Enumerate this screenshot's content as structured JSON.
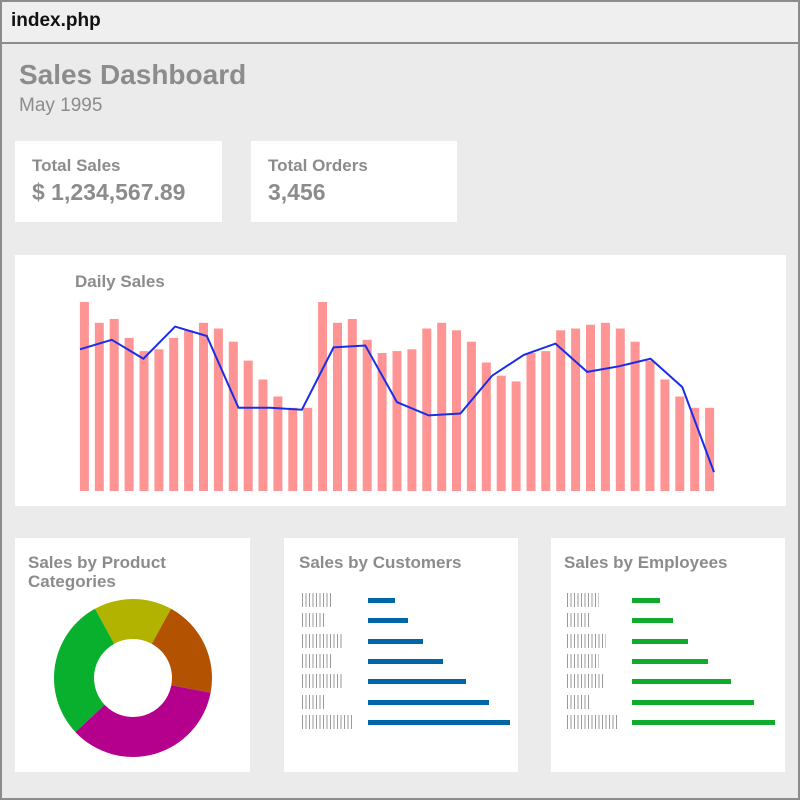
{
  "window": {
    "title": "index.php"
  },
  "header": {
    "title": "Sales Dashboard",
    "subtitle": "May 1995"
  },
  "kpis": {
    "total_sales": {
      "label": "Total Sales",
      "value": "$ 1,234,567.89"
    },
    "total_orders": {
      "label": "Total Orders",
      "value": "3,456"
    }
  },
  "daily_sales": {
    "title": "Daily Sales",
    "chart_data": {
      "type": "bar",
      "bar_color": "#ff9494",
      "line_color": "#1a2ee8",
      "series": [
        {
          "values": [
            100,
            89,
            91,
            81,
            74,
            75,
            81,
            85,
            89,
            86,
            79,
            69,
            59,
            50,
            44,
            44,
            100,
            89,
            91,
            80,
            73,
            74,
            75,
            86,
            89,
            85,
            79,
            68,
            61,
            58,
            73,
            74,
            85,
            86,
            88,
            89,
            86,
            79,
            69,
            59,
            50,
            44,
            44
          ]
        },
        {
          "values": [
            75,
            80,
            70,
            87,
            82,
            44,
            44,
            43,
            76,
            77,
            47,
            40,
            41,
            61,
            72,
            78,
            63,
            66,
            70,
            55,
            10
          ]
        }
      ]
    }
  },
  "categories": {
    "title": "Sales by Product Categories",
    "chart_data": {
      "type": "pie",
      "slices": [
        {
          "value": 16,
          "color": "#b2b200"
        },
        {
          "value": 20,
          "color": "#b35200"
        },
        {
          "value": 35,
          "color": "#b5008e"
        },
        {
          "value": 29,
          "color": "#08b02e"
        }
      ]
    }
  },
  "customers": {
    "title": "Sales by Customers",
    "bar_color": "#0066a8",
    "chart_data": {
      "type": "bar",
      "orientation": "horizontal",
      "values": [
        27,
        40,
        55,
        75,
        98,
        121,
        142
      ]
    }
  },
  "employees": {
    "title": "Sales by Employees",
    "bar_color": "#10aa2c",
    "chart_data": {
      "type": "bar",
      "orientation": "horizontal",
      "values": [
        28,
        41,
        56,
        76,
        99,
        122,
        143
      ]
    }
  }
}
